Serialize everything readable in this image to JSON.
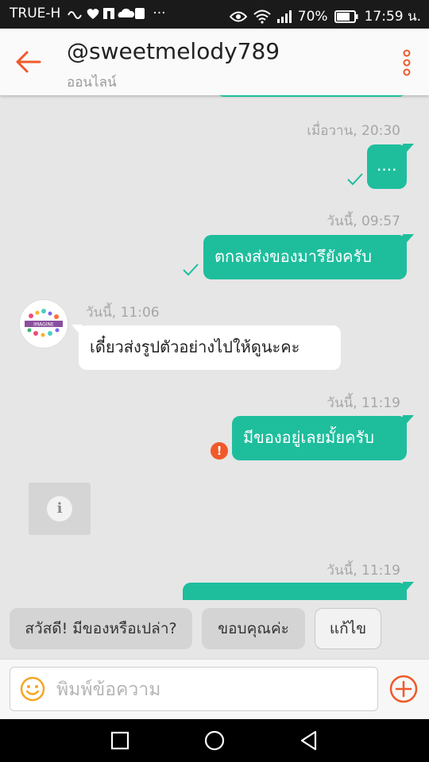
{
  "status_bar": {
    "carrier": "TRUE-H",
    "battery": "70%",
    "time": "17:59 น."
  },
  "header": {
    "title": "@sweetmelody789",
    "subtitle": "ออนไลน์"
  },
  "messages": [
    {
      "timestamp": "เมื่อวาน, 20:30",
      "text": "...."
    },
    {
      "timestamp": "วันนี้, 09:57",
      "text": "ตกลงส่งของมารึยังครับ"
    },
    {
      "timestamp": "วันนี้, 11:06",
      "text": "เดี๋ยวส่งรูปตัวอย่างไปให้ดูนะคะ"
    },
    {
      "timestamp": "วันนี้, 11:19",
      "text": "มีของอยู่เลยมั้ยครับ"
    },
    {
      "timestamp": "วันนี้, 11:19",
      "text": ""
    }
  ],
  "avatar_logo_text": "IMAGINE",
  "error_mark": "!",
  "info_mark": "i",
  "quick_replies": [
    "สวัสดี! มีของหรือเปล่า?",
    "ขอบคุณค่ะ",
    "แก้ไข"
  ],
  "composer": {
    "placeholder": "พิมพ์ข้อความ"
  },
  "colors": {
    "accent": "#f0592a",
    "outgoing_bubble": "#1ebe9d",
    "background": "#e6e6e6"
  },
  "icons": {
    "back": "arrow-left-icon",
    "more": "more-vertical-icon",
    "emoji": "smile-icon",
    "add": "plus-circle-icon"
  }
}
